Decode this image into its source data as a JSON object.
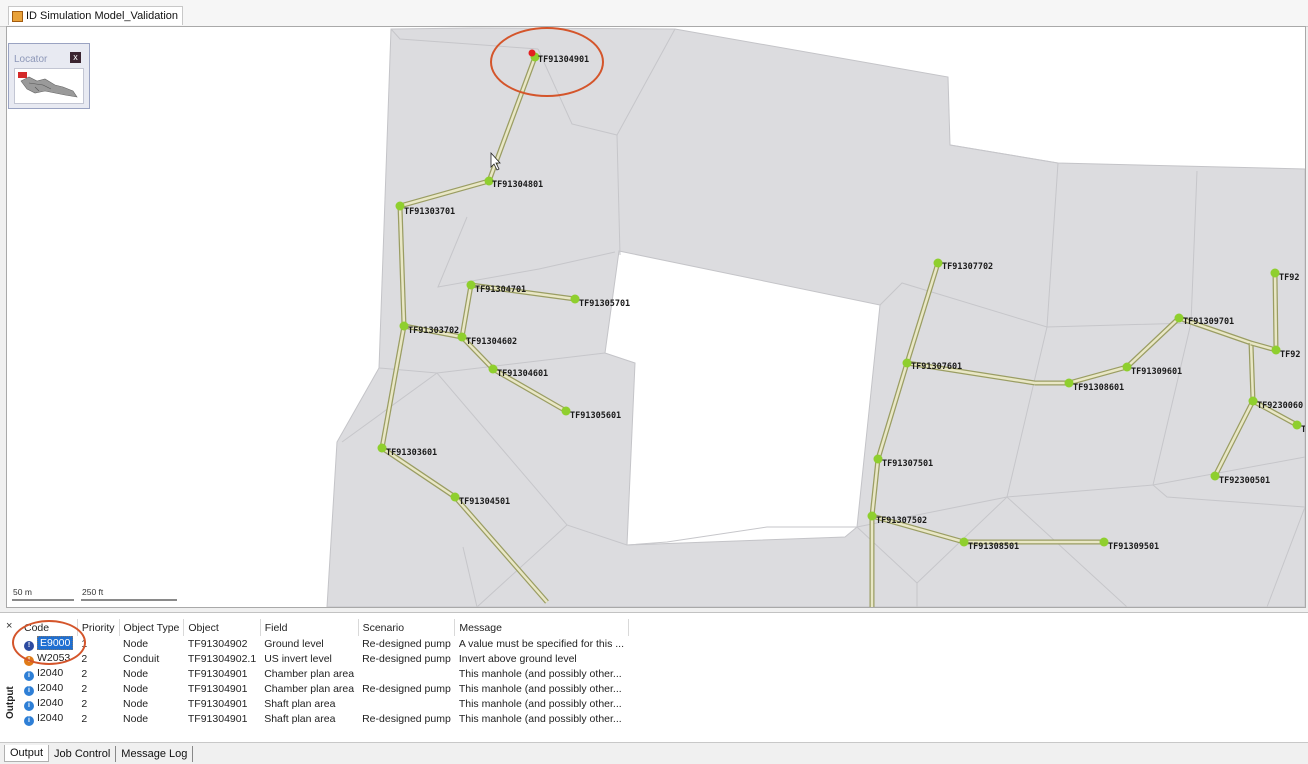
{
  "window": {
    "document_tab": "ID Simulation Model_Validation"
  },
  "locator": {
    "title": "Locator",
    "close": "x"
  },
  "scale": {
    "metric": "50 m",
    "imperial": "250 ft"
  },
  "map_nodes": [
    {
      "label": "TF91304901"
    },
    {
      "label": "TF91304801"
    },
    {
      "label": "TF91303701"
    },
    {
      "label": "TF91304701"
    },
    {
      "label": "TF91305701"
    },
    {
      "label": "TF91303702"
    },
    {
      "label": "TF91304602"
    },
    {
      "label": "TF91304601"
    },
    {
      "label": "TF91305601"
    },
    {
      "label": "TF91303601"
    },
    {
      "label": "TF91304501"
    },
    {
      "label": "TF91307702"
    },
    {
      "label": "TF91309701"
    },
    {
      "label": "TF91307601"
    },
    {
      "label": "TF91308601"
    },
    {
      "label": "TF91309601"
    },
    {
      "label": "TF91307501"
    },
    {
      "label": "TF91307502"
    },
    {
      "label": "TF91308501"
    },
    {
      "label": "TF91309501"
    },
    {
      "label": "TF92300501"
    },
    {
      "label": "TF9230060"
    },
    {
      "label": "TF92"
    },
    {
      "label": "TF92"
    },
    {
      "label": "TF"
    }
  ],
  "output": {
    "side_label": "Output",
    "close": "×",
    "columns": [
      "Code",
      "Priority",
      "Object Type",
      "Object",
      "Field",
      "Scenario",
      "Message"
    ],
    "rows": [
      {
        "severity": "error",
        "code": "E9000",
        "priority": "1",
        "object_type": "Node",
        "object": "TF91304902",
        "field": "Ground level",
        "scenario": "Re-designed pump",
        "message": "A value must be specified for this ..."
      },
      {
        "severity": "warn",
        "code": "W2053",
        "priority": "2",
        "object_type": "Conduit",
        "object": "TF91304902.1",
        "field": "US invert level",
        "scenario": "Re-designed pump",
        "message": "Invert above ground level"
      },
      {
        "severity": "info",
        "code": "I2040",
        "priority": "2",
        "object_type": "Node",
        "object": "TF91304901",
        "field": "Chamber plan area",
        "scenario": "",
        "message": "This manhole (and possibly other..."
      },
      {
        "severity": "info",
        "code": "I2040",
        "priority": "2",
        "object_type": "Node",
        "object": "TF91304901",
        "field": "Chamber plan area",
        "scenario": "Re-designed pump",
        "message": "This manhole (and possibly other..."
      },
      {
        "severity": "info",
        "code": "I2040",
        "priority": "2",
        "object_type": "Node",
        "object": "TF91304901",
        "field": "Shaft plan area",
        "scenario": "",
        "message": "This manhole (and possibly other..."
      },
      {
        "severity": "info",
        "code": "I2040",
        "priority": "2",
        "object_type": "Node",
        "object": "TF91304901",
        "field": "Shaft plan area",
        "scenario": "Re-designed pump",
        "message": "This manhole (and possibly other..."
      }
    ]
  },
  "bottom_tabs": [
    "Output",
    "Job Control",
    "Message Log"
  ],
  "colors": {
    "subcatchment": "#dcdcdf",
    "pipe": "#b8bc7c",
    "node": "#8fcf2e",
    "annotation": "#d4552b",
    "selected_node": "#e32020"
  }
}
